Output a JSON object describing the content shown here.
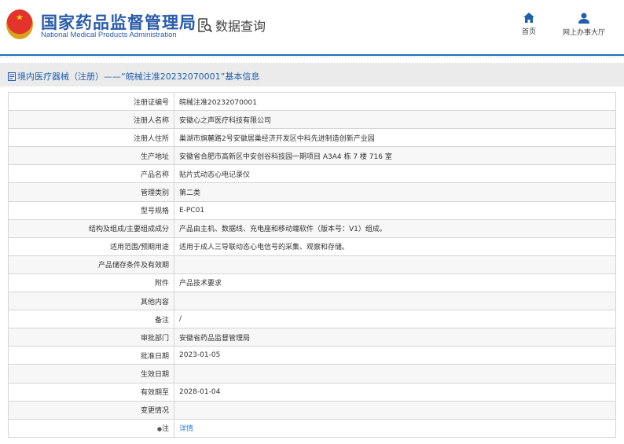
{
  "header": {
    "title_cn": "国家药品监督管理局",
    "title_en": "National Medical Products Administration",
    "data_query": "数据查询",
    "nav": [
      {
        "label": "首页",
        "icon": "home-icon"
      },
      {
        "label": "网上办事大厅",
        "icon": "user-icon"
      }
    ]
  },
  "breadcrumb": {
    "text": "境内医疗器械（注册）——“皖械注准20232070001”基本信息"
  },
  "rows": [
    {
      "label": "注册证编号",
      "value": "皖械注准20232070001"
    },
    {
      "label": "注册人名称",
      "value": "安徽心之声医疗科技有限公司"
    },
    {
      "label": "注册人住所",
      "value": "巢湖市旗麓路2号安徽居巢经济开发区中科先进制造创新产业园"
    },
    {
      "label": "生产地址",
      "value": "安徽省合肥市高新区中安创谷科技园一期项目 A3A4 栋 7 楼 716 室"
    },
    {
      "label": "产品名称",
      "value": "贴片式动态心电记录仪"
    },
    {
      "label": "管理类别",
      "value": "第二类"
    },
    {
      "label": "型号规格",
      "value": "E-PC01"
    },
    {
      "label": "结构及组成/主要组成成分",
      "value": "产品由主机、数据线、充电座和移动端软件（版本号：V1）组成。"
    },
    {
      "label": "适用范围/预期用途",
      "value": "适用于成人三导联动态心电信号的采集、观察和存储。"
    },
    {
      "label": "产品储存条件及有效期",
      "value": ""
    },
    {
      "label": "附件",
      "value": "产品技术要求"
    },
    {
      "label": "其他内容",
      "value": ""
    },
    {
      "label": "备注",
      "value": "/"
    },
    {
      "label": "审批部门",
      "value": "安徽省药品监督管理局"
    },
    {
      "label": "批准日期",
      "value": "2023-01-05"
    },
    {
      "label": "生效日期",
      "value": ""
    },
    {
      "label": "有效期至",
      "value": "2028-01-04"
    },
    {
      "label": "变更情况",
      "value": ""
    },
    {
      "label": "注",
      "value": "详情"
    }
  ]
}
